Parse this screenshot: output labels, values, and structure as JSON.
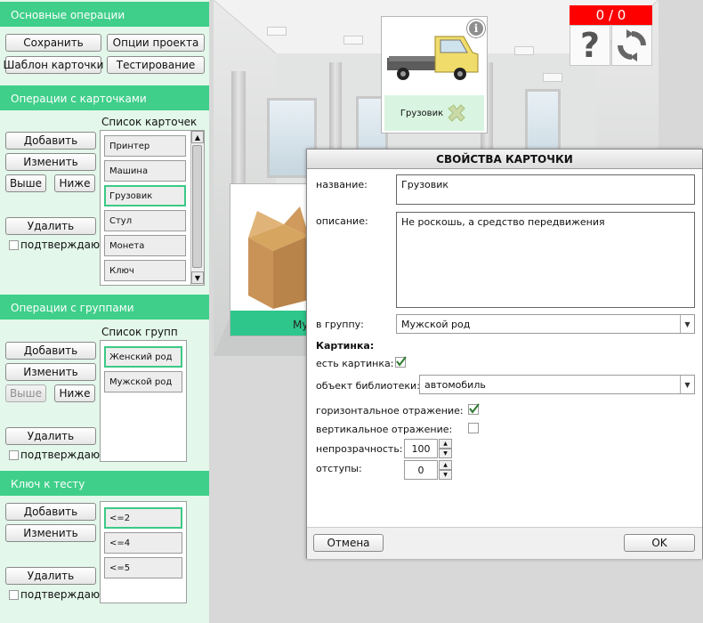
{
  "sections": {
    "basic": {
      "title": "Основные операции",
      "save": "Сохранить",
      "project_options": "Опции проекта",
      "card_template": "Шаблон карточки",
      "testing": "Тестирование"
    },
    "cards": {
      "title": "Операции с карточками",
      "list_title": "Список карточек",
      "add": "Добавить",
      "edit": "Изменить",
      "up": "Выше",
      "down": "Ниже",
      "delete": "Удалить",
      "confirm": "подтверждаю",
      "items": [
        "Принтер",
        "Машина",
        "Грузовик",
        "Стул",
        "Монета",
        "Ключ"
      ]
    },
    "groups": {
      "title": "Операции с группами",
      "list_title": "Список групп",
      "add": "Добавить",
      "edit": "Изменить",
      "up": "Выше",
      "down": "Ниже",
      "delete": "Удалить",
      "confirm": "подтверждаю",
      "items": [
        "Женский род",
        "Мужской род"
      ]
    },
    "key": {
      "title": "Ключ к тесту",
      "add": "Добавить",
      "edit": "Изменить",
      "delete": "Удалить",
      "confirm": "подтверждаю",
      "items": [
        "<=2",
        "<=4",
        "<=5"
      ]
    }
  },
  "scene": {
    "score": "0 / 0",
    "truck_card_caption": "Грузовик",
    "box_card_caption_partial": "Му",
    "info_icon_text": "i",
    "help_icon_text": "?"
  },
  "dialog": {
    "title": "СВОЙСТВА КАРТОЧКИ",
    "name_label": "название:",
    "name_value": "Грузовик",
    "description_label": "описание:",
    "description_value": "Не роскошь, а средство передвижения",
    "group_label": "в группу:",
    "group_value": "Мужской род",
    "picture_header": "Картинка:",
    "has_picture_label": "есть картинка:",
    "library_object_label": "объект библиотеки:",
    "library_object_value": "автомобиль",
    "horizontal_flip_label": "горизонтальное отражение:",
    "vertical_flip_label": "вертикальное отражение:",
    "opacity_label": "непрозрачность:",
    "opacity_value": "100",
    "padding_label": "отступы:",
    "padding_value": "0",
    "cancel": "Отмена",
    "ok": "OK"
  },
  "colors": {
    "section_header": "#3fcf8a",
    "panel_bg": "#e3f7ea",
    "selection": "#3cc986",
    "score_bg": "#ff0000"
  }
}
